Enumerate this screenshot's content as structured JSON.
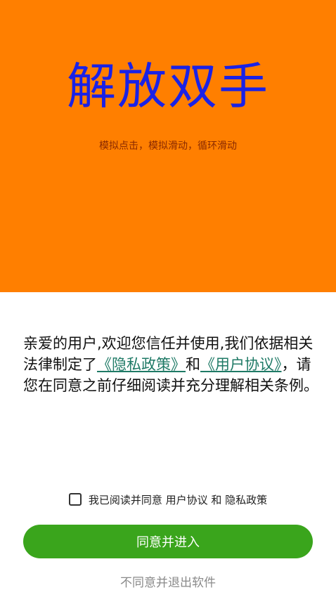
{
  "hero": {
    "title": "解放双手",
    "subtitle": "模拟点击，模拟滑动，循环滑动",
    "background_color": "#ff7f00",
    "title_color": "#1a22e6"
  },
  "agreement": {
    "text_1": "亲爱的用户,欢迎您信任并使用,我们依据相关法律制定了",
    "privacy_link": "《隐私政策》",
    "text_2": "和",
    "user_link": "《用户协议》",
    "text_3": "，请您在同意之前仔细阅读并充分理解相关条例。",
    "link_color": "#1f7a66"
  },
  "consent": {
    "checked": false,
    "prefix": "我已阅读并同意 ",
    "user_agreement": "用户协议",
    "conjunction": " 和 ",
    "privacy_policy": "隐私政策"
  },
  "buttons": {
    "agree_label": "同意并进入",
    "disagree_label": "不同意并退出软件",
    "agree_color": "#3aa51c"
  }
}
